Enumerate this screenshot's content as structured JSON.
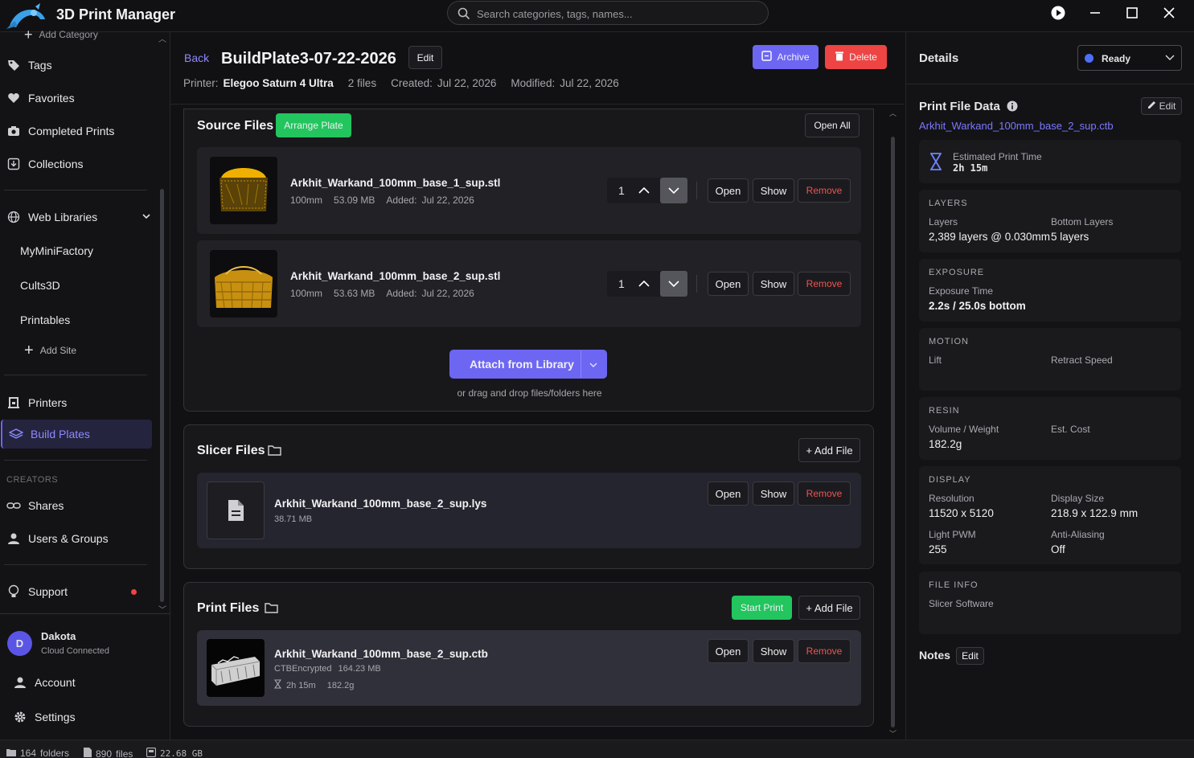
{
  "app": {
    "title": "3D Print Manager"
  },
  "search": {
    "placeholder": "Search categories, tags, names..."
  },
  "sidebar": {
    "add_category": "Add Category",
    "items": [
      "Tags",
      "Favorites",
      "Completed Prints",
      "Collections"
    ],
    "web_libraries": "Web Libraries",
    "sites": [
      "MyMiniFactory",
      "Cults3D",
      "Printables"
    ],
    "add_site": "Add Site",
    "printers": "Printers",
    "build_plates": "Build Plates",
    "creators_heading": "CREATORS",
    "shares": "Shares",
    "users_groups": "Users & Groups",
    "support": "Support",
    "user": {
      "initial": "D",
      "name": "Dakota",
      "status": "Cloud Connected"
    },
    "account": "Account",
    "settings": "Settings"
  },
  "header": {
    "back": "Back",
    "title": "BuildPlate3-07-22-2026",
    "edit": "Edit",
    "archive": "Archive",
    "delete": "Delete",
    "printer_label": "Printer:",
    "printer_value": "Elegoo Saturn 4 Ultra",
    "files_count": "2 files",
    "created_label": "Created:",
    "created_value": "Jul 22, 2026",
    "modified_label": "Modified:",
    "modified_value": "Jul 22, 2026"
  },
  "source_files": {
    "title": "Source Files",
    "arrange": "Arrange Plate",
    "open_all": "Open All",
    "files": [
      {
        "name": "Arkhit_Warkand_100mm_base_1_sup.stl",
        "dim": "100mm",
        "size": "53.09 MB",
        "added_label": "Added:",
        "added": "Jul 22, 2026",
        "qty": "1"
      },
      {
        "name": "Arkhit_Warkand_100mm_base_2_sup.stl",
        "dim": "100mm",
        "size": "53.63 MB",
        "added_label": "Added:",
        "added": "Jul 22, 2026",
        "qty": "1"
      }
    ],
    "attach": "Attach from Library",
    "drop_hint": "or drag and drop files/folders here"
  },
  "slicer_files": {
    "title": "Slicer Files",
    "add_file": "+ Add File",
    "file": {
      "name": "Arkhit_Warkand_100mm_base_2_sup.lys",
      "size": "38.71 MB"
    }
  },
  "print_files": {
    "title": "Print Files",
    "start_print": "Start Print",
    "add_file": "+ Add File",
    "file": {
      "name": "Arkhit_Warkand_100mm_base_2_sup.ctb",
      "type": "CTBEncrypted",
      "size": "164.23 MB",
      "time": "2h 15m",
      "weight": "182.2g"
    }
  },
  "row_actions": {
    "open": "Open",
    "show": "Show",
    "remove": "Remove"
  },
  "details": {
    "title": "Details",
    "status": "Ready",
    "print_file_data": "Print File Data",
    "edit": "Edit",
    "file_link": "Arkhit_Warkand_100mm_base_2_sup.ctb",
    "est_label": "Estimated Print Time",
    "est_value": "2h 15m",
    "layers": {
      "heading": "LAYERS",
      "l1": "Layers",
      "v1": "2,389 layers @ 0.030mm",
      "l2": "Bottom Layers",
      "v2": "5 layers"
    },
    "exposure": {
      "heading": "EXPOSURE",
      "l1": "Exposure Time",
      "v1": "2.2s / 25.0s bottom"
    },
    "motion": {
      "heading": "MOTION",
      "l1": "Lift",
      "l2": "Retract Speed"
    },
    "resin": {
      "heading": "RESIN",
      "l1": "Volume / Weight",
      "v1": "182.2g",
      "l2": "Est. Cost"
    },
    "display": {
      "heading": "DISPLAY",
      "l1": "Resolution",
      "v1": "11520 x 5120",
      "l2": "Display Size",
      "v2": "218.9 x 122.9 mm",
      "l3": "Light PWM",
      "v3": "255",
      "l4": "Anti-Aliasing",
      "v4": "Off"
    },
    "file_info": {
      "heading": "FILE INFO",
      "l1": "Slicer Software"
    },
    "notes": "Notes",
    "notes_edit": "Edit"
  },
  "statusbar": {
    "folders_count": "164",
    "folders": "folders",
    "files_count": "890",
    "files": "files",
    "disk": "22.68 GB"
  },
  "colors": {
    "accent": "#6d66f2",
    "green": "#22c55e",
    "red": "#ef4444",
    "link": "#7c78ff"
  }
}
